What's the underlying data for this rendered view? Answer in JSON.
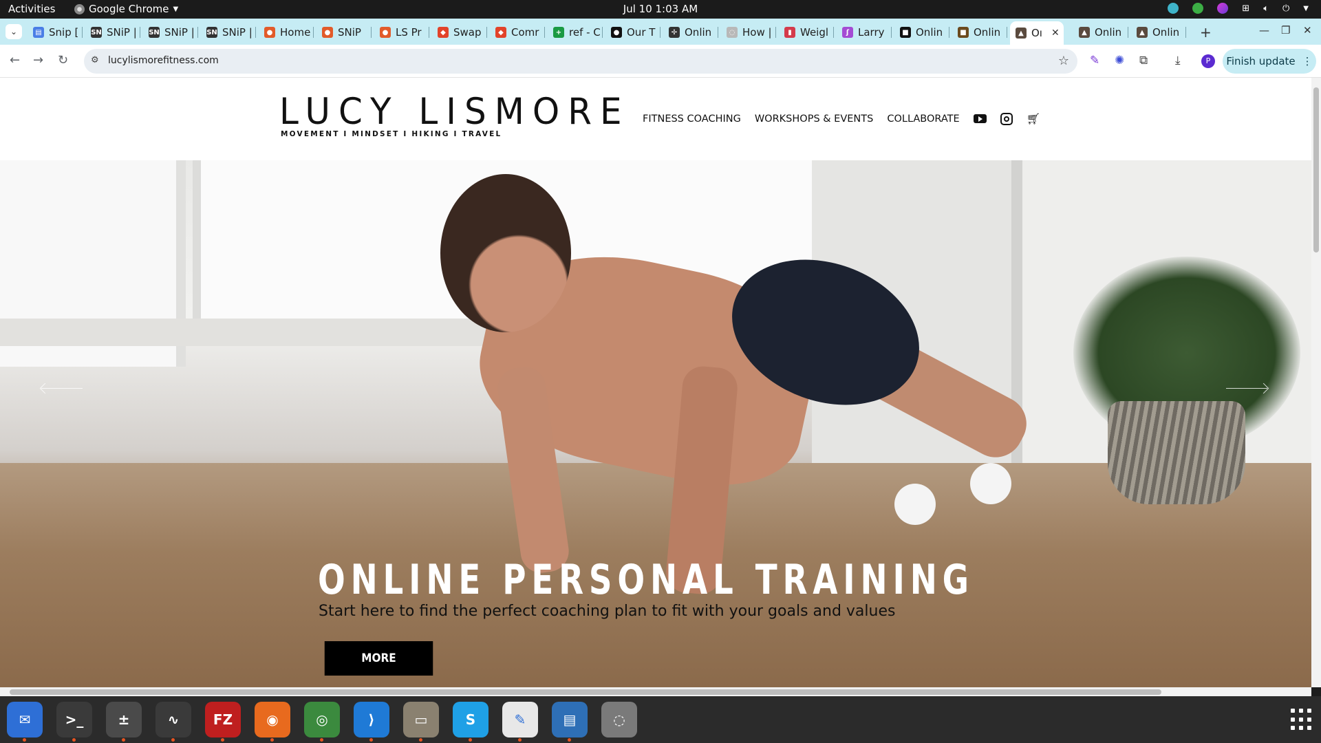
{
  "system_bar": {
    "activities": "Activities",
    "app_name": "Google Chrome",
    "clock": "Jul 10  1:03 AM"
  },
  "tabs": [
    {
      "title": "Snip [",
      "favicon_color": "#4a7ee6",
      "favicon_label": "▤"
    },
    {
      "title": "SNiP |",
      "favicon_color": "#333333",
      "favicon_label": "SN"
    },
    {
      "title": "SNiP |",
      "favicon_color": "#333333",
      "favicon_label": "SN"
    },
    {
      "title": "SNiP |",
      "favicon_color": "#333333",
      "favicon_label": "SN"
    },
    {
      "title": "Home",
      "favicon_color": "#e25b2a",
      "favicon_label": "●"
    },
    {
      "title": "SNiP",
      "favicon_color": "#e25b2a",
      "favicon_label": "●"
    },
    {
      "title": "LS Pr",
      "favicon_color": "#e25b2a",
      "favicon_label": "●"
    },
    {
      "title": "Swap",
      "favicon_color": "#e2432a",
      "favicon_label": "◆"
    },
    {
      "title": "Comr",
      "favicon_color": "#e2432a",
      "favicon_label": "◆"
    },
    {
      "title": "ref - C",
      "favicon_color": "#1a9a43",
      "favicon_label": "+"
    },
    {
      "title": "Our T",
      "favicon_color": "#111111",
      "favicon_label": "●"
    },
    {
      "title": "Onlin",
      "favicon_color": "#333333",
      "favicon_label": "✢"
    },
    {
      "title": "How |",
      "favicon_color": "#b8b8b8",
      "favicon_label": "◌"
    },
    {
      "title": "Weigl",
      "favicon_color": "#d43b4c",
      "favicon_label": "▮"
    },
    {
      "title": "Larry",
      "favicon_color": "#a44bd4",
      "favicon_label": "ʃ"
    },
    {
      "title": "Onlin",
      "favicon_color": "#111111",
      "favicon_label": "■"
    },
    {
      "title": "Onlin",
      "favicon_color": "#6b4a1e",
      "favicon_label": "■"
    },
    {
      "title": "Oı",
      "favicon_color": "#5a4a3e",
      "favicon_label": "▲",
      "active": true
    },
    {
      "title": "Onlin",
      "favicon_color": "#5a4a3e",
      "favicon_label": "▲"
    },
    {
      "title": "Onlin",
      "favicon_color": "#5a4a3e",
      "favicon_label": "▲"
    }
  ],
  "toolbar": {
    "url": "lucylismorefitness.com",
    "profile_initial": "P",
    "finish_update_label": "Finish update"
  },
  "site": {
    "logo_title": "LUCY LISMORE",
    "logo_subtitle": "MOVEMENT I MINDSET I HIKING I TRAVEL",
    "nav": [
      "FITNESS COACHING",
      "WORKSHOPS & EVENTS",
      "COLLABORATE"
    ],
    "hero_title": "ONLINE PERSONAL TRAINING",
    "hero_subtitle": "Start here to find the perfect coaching plan to fit with your goals and values",
    "hero_button": "MORE"
  },
  "dock": [
    {
      "name": "thunderbird",
      "color": "#2e6fd6",
      "label": "✉",
      "running": true
    },
    {
      "name": "terminal",
      "color": "#3a3a3a",
      "label": ">_",
      "running": true
    },
    {
      "name": "calculator",
      "color": "#4a4a4a",
      "label": "±",
      "running": true
    },
    {
      "name": "system-monitor",
      "color": "#3a3a3a",
      "label": "∿",
      "running": true
    },
    {
      "name": "filezilla",
      "color": "#bf1f1f",
      "label": "FZ",
      "running": true
    },
    {
      "name": "firefox",
      "color": "#e86a1e",
      "label": "◉",
      "running": true
    },
    {
      "name": "chrome",
      "color": "#3b8a3e",
      "label": "◎",
      "running": true
    },
    {
      "name": "vscode",
      "color": "#1f7ad6",
      "label": "⟩",
      "running": true
    },
    {
      "name": "files",
      "color": "#8a8170",
      "label": "▭",
      "running": true
    },
    {
      "name": "skype",
      "color": "#1fa0e6",
      "label": "S",
      "running": true
    },
    {
      "name": "text-editor",
      "color": "#e8e8e8",
      "label": "✎",
      "running": true
    },
    {
      "name": "writer",
      "color": "#2e6fb6",
      "label": "▤",
      "running": true
    },
    {
      "name": "disk-utility",
      "color": "#7a7a7a",
      "label": "◌",
      "running": false
    }
  ]
}
